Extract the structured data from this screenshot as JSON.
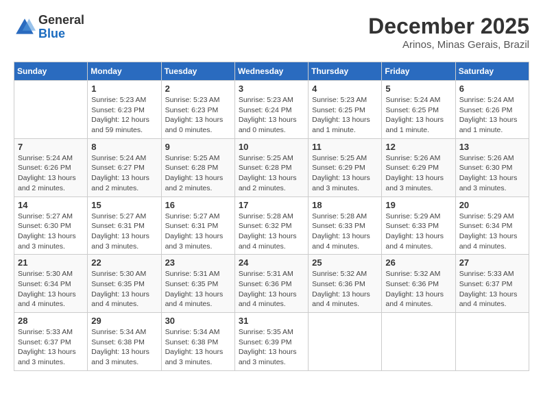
{
  "header": {
    "logo_general": "General",
    "logo_blue": "Blue",
    "month_year": "December 2025",
    "location": "Arinos, Minas Gerais, Brazil"
  },
  "days_of_week": [
    "Sunday",
    "Monday",
    "Tuesday",
    "Wednesday",
    "Thursday",
    "Friday",
    "Saturday"
  ],
  "weeks": [
    [
      {
        "day": "",
        "info": ""
      },
      {
        "day": "1",
        "info": "Sunrise: 5:23 AM\nSunset: 6:23 PM\nDaylight: 12 hours\nand 59 minutes."
      },
      {
        "day": "2",
        "info": "Sunrise: 5:23 AM\nSunset: 6:23 PM\nDaylight: 13 hours\nand 0 minutes."
      },
      {
        "day": "3",
        "info": "Sunrise: 5:23 AM\nSunset: 6:24 PM\nDaylight: 13 hours\nand 0 minutes."
      },
      {
        "day": "4",
        "info": "Sunrise: 5:23 AM\nSunset: 6:25 PM\nDaylight: 13 hours\nand 1 minute."
      },
      {
        "day": "5",
        "info": "Sunrise: 5:24 AM\nSunset: 6:25 PM\nDaylight: 13 hours\nand 1 minute."
      },
      {
        "day": "6",
        "info": "Sunrise: 5:24 AM\nSunset: 6:26 PM\nDaylight: 13 hours\nand 1 minute."
      }
    ],
    [
      {
        "day": "7",
        "info": "Sunrise: 5:24 AM\nSunset: 6:26 PM\nDaylight: 13 hours\nand 2 minutes."
      },
      {
        "day": "8",
        "info": "Sunrise: 5:24 AM\nSunset: 6:27 PM\nDaylight: 13 hours\nand 2 minutes."
      },
      {
        "day": "9",
        "info": "Sunrise: 5:25 AM\nSunset: 6:28 PM\nDaylight: 13 hours\nand 2 minutes."
      },
      {
        "day": "10",
        "info": "Sunrise: 5:25 AM\nSunset: 6:28 PM\nDaylight: 13 hours\nand 2 minutes."
      },
      {
        "day": "11",
        "info": "Sunrise: 5:25 AM\nSunset: 6:29 PM\nDaylight: 13 hours\nand 3 minutes."
      },
      {
        "day": "12",
        "info": "Sunrise: 5:26 AM\nSunset: 6:29 PM\nDaylight: 13 hours\nand 3 minutes."
      },
      {
        "day": "13",
        "info": "Sunrise: 5:26 AM\nSunset: 6:30 PM\nDaylight: 13 hours\nand 3 minutes."
      }
    ],
    [
      {
        "day": "14",
        "info": "Sunrise: 5:27 AM\nSunset: 6:30 PM\nDaylight: 13 hours\nand 3 minutes."
      },
      {
        "day": "15",
        "info": "Sunrise: 5:27 AM\nSunset: 6:31 PM\nDaylight: 13 hours\nand 3 minutes."
      },
      {
        "day": "16",
        "info": "Sunrise: 5:27 AM\nSunset: 6:31 PM\nDaylight: 13 hours\nand 3 minutes."
      },
      {
        "day": "17",
        "info": "Sunrise: 5:28 AM\nSunset: 6:32 PM\nDaylight: 13 hours\nand 4 minutes."
      },
      {
        "day": "18",
        "info": "Sunrise: 5:28 AM\nSunset: 6:33 PM\nDaylight: 13 hours\nand 4 minutes."
      },
      {
        "day": "19",
        "info": "Sunrise: 5:29 AM\nSunset: 6:33 PM\nDaylight: 13 hours\nand 4 minutes."
      },
      {
        "day": "20",
        "info": "Sunrise: 5:29 AM\nSunset: 6:34 PM\nDaylight: 13 hours\nand 4 minutes."
      }
    ],
    [
      {
        "day": "21",
        "info": "Sunrise: 5:30 AM\nSunset: 6:34 PM\nDaylight: 13 hours\nand 4 minutes."
      },
      {
        "day": "22",
        "info": "Sunrise: 5:30 AM\nSunset: 6:35 PM\nDaylight: 13 hours\nand 4 minutes."
      },
      {
        "day": "23",
        "info": "Sunrise: 5:31 AM\nSunset: 6:35 PM\nDaylight: 13 hours\nand 4 minutes."
      },
      {
        "day": "24",
        "info": "Sunrise: 5:31 AM\nSunset: 6:36 PM\nDaylight: 13 hours\nand 4 minutes."
      },
      {
        "day": "25",
        "info": "Sunrise: 5:32 AM\nSunset: 6:36 PM\nDaylight: 13 hours\nand 4 minutes."
      },
      {
        "day": "26",
        "info": "Sunrise: 5:32 AM\nSunset: 6:36 PM\nDaylight: 13 hours\nand 4 minutes."
      },
      {
        "day": "27",
        "info": "Sunrise: 5:33 AM\nSunset: 6:37 PM\nDaylight: 13 hours\nand 4 minutes."
      }
    ],
    [
      {
        "day": "28",
        "info": "Sunrise: 5:33 AM\nSunset: 6:37 PM\nDaylight: 13 hours\nand 3 minutes."
      },
      {
        "day": "29",
        "info": "Sunrise: 5:34 AM\nSunset: 6:38 PM\nDaylight: 13 hours\nand 3 minutes."
      },
      {
        "day": "30",
        "info": "Sunrise: 5:34 AM\nSunset: 6:38 PM\nDaylight: 13 hours\nand 3 minutes."
      },
      {
        "day": "31",
        "info": "Sunrise: 5:35 AM\nSunset: 6:39 PM\nDaylight: 13 hours\nand 3 minutes."
      },
      {
        "day": "",
        "info": ""
      },
      {
        "day": "",
        "info": ""
      },
      {
        "day": "",
        "info": ""
      }
    ]
  ]
}
